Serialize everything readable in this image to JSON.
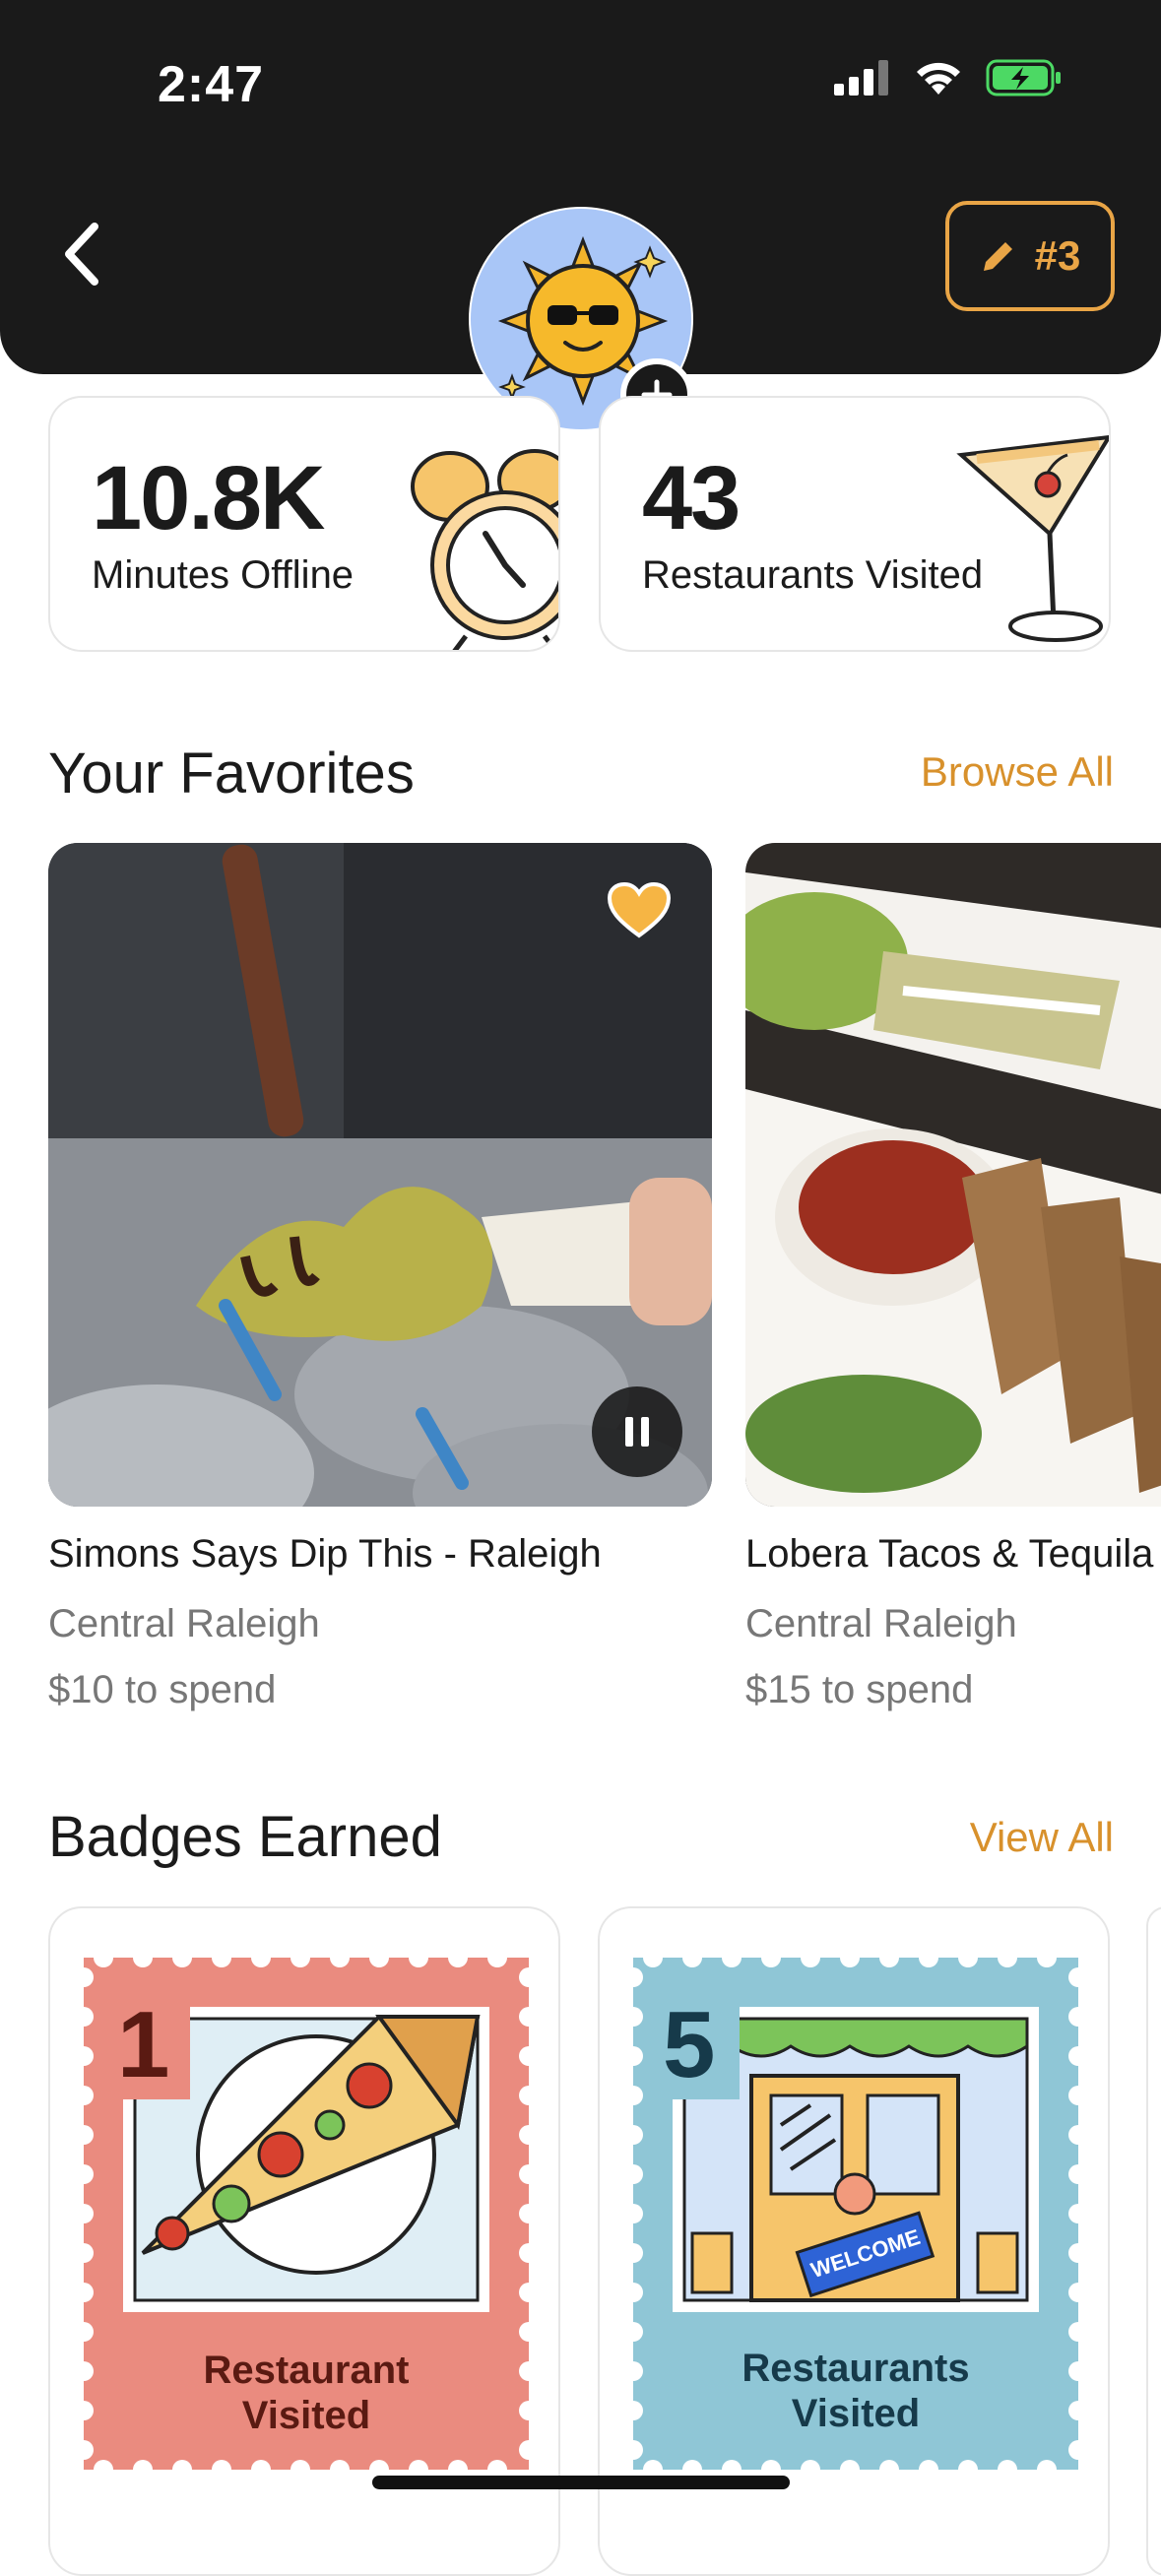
{
  "status_bar": {
    "time": "2:47"
  },
  "header": {
    "rank_label": "#3"
  },
  "stats": [
    {
      "value": "10.8K",
      "label": "Minutes Offline"
    },
    {
      "value": "43",
      "label": "Restaurants Visited"
    }
  ],
  "favorites": {
    "title": "Your Favorites",
    "link": "Browse All",
    "items": [
      {
        "name": "Simons Says Dip This - Raleigh",
        "area": "Central Raleigh",
        "spend": "$10 to spend"
      },
      {
        "name": "Lobera Tacos & Tequila",
        "area": "Central Raleigh",
        "spend": "$15 to spend"
      }
    ]
  },
  "badges": {
    "title": "Badges Earned",
    "link": "View All",
    "items": [
      {
        "number": "1",
        "line1": "Restaurant",
        "line2": "Visited"
      },
      {
        "number": "5",
        "line1": "Restaurants",
        "line2": "Visited",
        "sign": "WELCOME"
      }
    ]
  },
  "colors": {
    "accent": "#e9a546",
    "link": "#d8912c",
    "header_bg": "#1a1a1a",
    "avatar_bg": "#a9c6f7",
    "badge1_bg": "#ea8b7f",
    "badge2_bg": "#8fc6d6"
  }
}
